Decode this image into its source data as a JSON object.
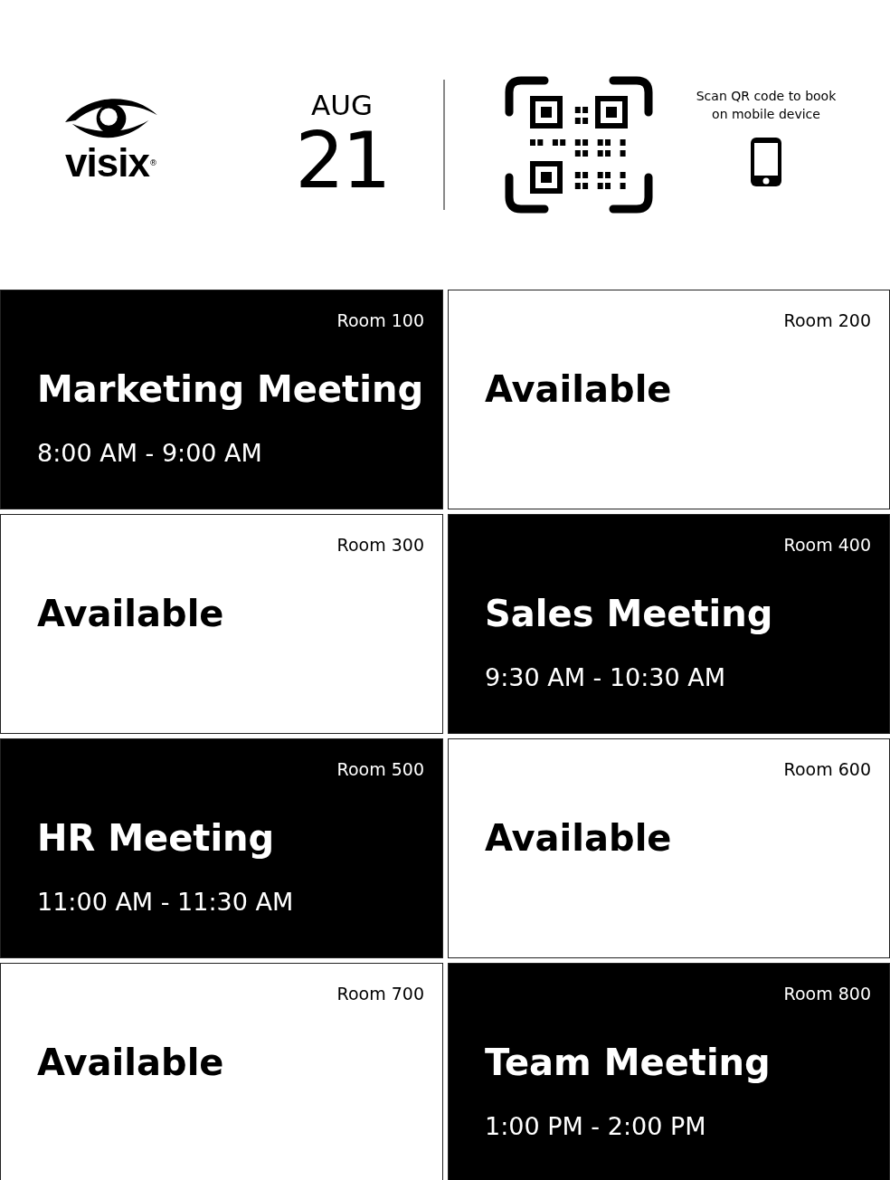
{
  "header": {
    "logo": "visix",
    "logo_mark": "®",
    "month": "AUG",
    "day": "21",
    "qr_caption": "Scan QR code to book on mobile device"
  },
  "rooms": [
    {
      "room": "Room 100",
      "kind": "booked",
      "title": "Marketing Meeting",
      "time": "8:00 AM - 9:00 AM"
    },
    {
      "room": "Room 200",
      "kind": "available",
      "title": "Available"
    },
    {
      "room": "Room 300",
      "kind": "available",
      "title": "Available"
    },
    {
      "room": "Room 400",
      "kind": "booked",
      "title": "Sales Meeting",
      "time": "9:30 AM - 10:30 AM"
    },
    {
      "room": "Room 500",
      "kind": "booked",
      "title": "HR Meeting",
      "time": "11:00 AM - 11:30 AM"
    },
    {
      "room": "Room 600",
      "kind": "available",
      "title": "Available"
    },
    {
      "room": "Room 700",
      "kind": "available",
      "title": "Available"
    },
    {
      "room": "Room 800",
      "kind": "booked",
      "title": "Team Meeting",
      "time": "1:00 PM - 2:00 PM"
    }
  ]
}
